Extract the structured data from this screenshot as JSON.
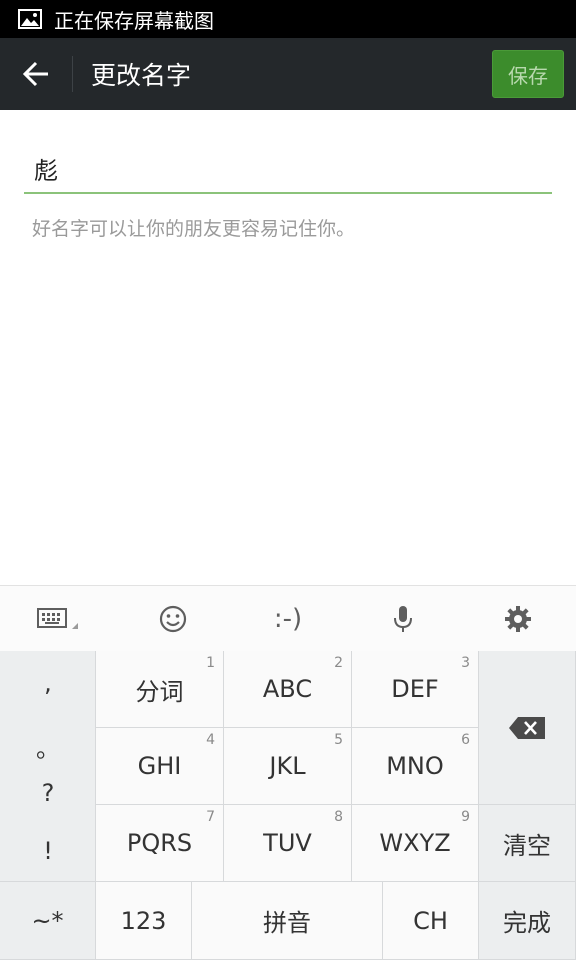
{
  "statusbar": {
    "text": "正在保存屏幕截图",
    "icon": "image-icon"
  },
  "header": {
    "back_icon": "arrow-left-icon",
    "title": "更改名字",
    "save_label": "保存"
  },
  "form": {
    "name_value": "彪",
    "hint": "好名字可以让你的朋友更容易记住你。"
  },
  "keyboard_toolbar": {
    "items": [
      {
        "icon": "keyboard-icon"
      },
      {
        "icon": "emoji-icon"
      },
      {
        "label": ":-)"
      },
      {
        "icon": "microphone-icon"
      },
      {
        "icon": "gear-icon"
      }
    ]
  },
  "keyboard": {
    "punctuation": [
      ",",
      "。",
      "?",
      "!"
    ],
    "rows": [
      [
        {
          "label": "分词",
          "num": "1"
        },
        {
          "label": "ABC",
          "num": "2"
        },
        {
          "label": "DEF",
          "num": "3"
        }
      ],
      [
        {
          "label": "GHI",
          "num": "4"
        },
        {
          "label": "JKL",
          "num": "5"
        },
        {
          "label": "MNO",
          "num": "6"
        }
      ],
      [
        {
          "label": "PQRS",
          "num": "7"
        },
        {
          "label": "TUV",
          "num": "8"
        },
        {
          "label": "WXYZ",
          "num": "9"
        }
      ]
    ],
    "backspace_icon": "backspace-icon",
    "clear_label": "清空",
    "symbols_label": "~*",
    "numbers_label": "123",
    "pinyin_label": "拼音",
    "lang_label": "CH",
    "done_label": "完成"
  }
}
